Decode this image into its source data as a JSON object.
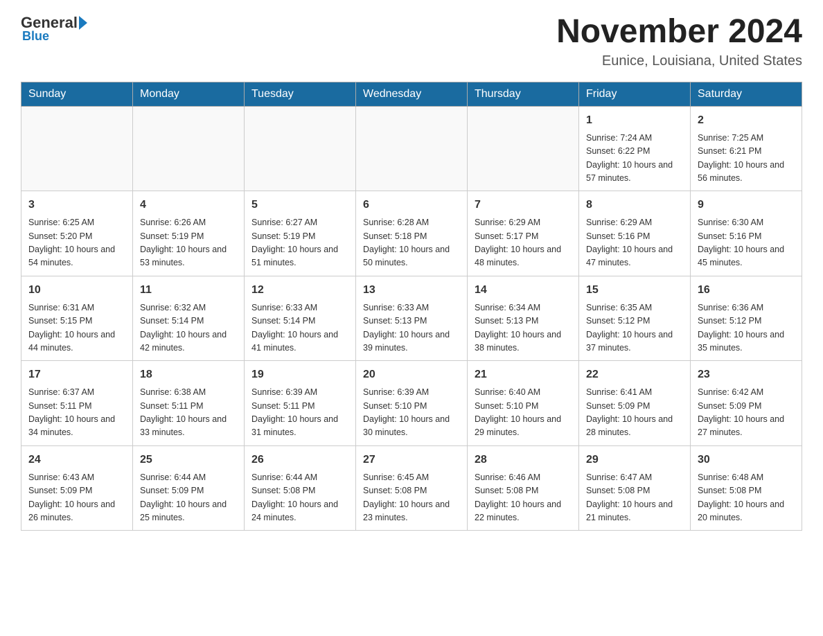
{
  "logo": {
    "general": "General",
    "blue": "Blue"
  },
  "title": {
    "month_year": "November 2024",
    "location": "Eunice, Louisiana, United States"
  },
  "headers": [
    "Sunday",
    "Monday",
    "Tuesday",
    "Wednesday",
    "Thursday",
    "Friday",
    "Saturday"
  ],
  "weeks": [
    [
      {
        "day": "",
        "sunrise": "",
        "sunset": "",
        "daylight": ""
      },
      {
        "day": "",
        "sunrise": "",
        "sunset": "",
        "daylight": ""
      },
      {
        "day": "",
        "sunrise": "",
        "sunset": "",
        "daylight": ""
      },
      {
        "day": "",
        "sunrise": "",
        "sunset": "",
        "daylight": ""
      },
      {
        "day": "",
        "sunrise": "",
        "sunset": "",
        "daylight": ""
      },
      {
        "day": "1",
        "sunrise": "Sunrise: 7:24 AM",
        "sunset": "Sunset: 6:22 PM",
        "daylight": "Daylight: 10 hours and 57 minutes."
      },
      {
        "day": "2",
        "sunrise": "Sunrise: 7:25 AM",
        "sunset": "Sunset: 6:21 PM",
        "daylight": "Daylight: 10 hours and 56 minutes."
      }
    ],
    [
      {
        "day": "3",
        "sunrise": "Sunrise: 6:25 AM",
        "sunset": "Sunset: 5:20 PM",
        "daylight": "Daylight: 10 hours and 54 minutes."
      },
      {
        "day": "4",
        "sunrise": "Sunrise: 6:26 AM",
        "sunset": "Sunset: 5:19 PM",
        "daylight": "Daylight: 10 hours and 53 minutes."
      },
      {
        "day": "5",
        "sunrise": "Sunrise: 6:27 AM",
        "sunset": "Sunset: 5:19 PM",
        "daylight": "Daylight: 10 hours and 51 minutes."
      },
      {
        "day": "6",
        "sunrise": "Sunrise: 6:28 AM",
        "sunset": "Sunset: 5:18 PM",
        "daylight": "Daylight: 10 hours and 50 minutes."
      },
      {
        "day": "7",
        "sunrise": "Sunrise: 6:29 AM",
        "sunset": "Sunset: 5:17 PM",
        "daylight": "Daylight: 10 hours and 48 minutes."
      },
      {
        "day": "8",
        "sunrise": "Sunrise: 6:29 AM",
        "sunset": "Sunset: 5:16 PM",
        "daylight": "Daylight: 10 hours and 47 minutes."
      },
      {
        "day": "9",
        "sunrise": "Sunrise: 6:30 AM",
        "sunset": "Sunset: 5:16 PM",
        "daylight": "Daylight: 10 hours and 45 minutes."
      }
    ],
    [
      {
        "day": "10",
        "sunrise": "Sunrise: 6:31 AM",
        "sunset": "Sunset: 5:15 PM",
        "daylight": "Daylight: 10 hours and 44 minutes."
      },
      {
        "day": "11",
        "sunrise": "Sunrise: 6:32 AM",
        "sunset": "Sunset: 5:14 PM",
        "daylight": "Daylight: 10 hours and 42 minutes."
      },
      {
        "day": "12",
        "sunrise": "Sunrise: 6:33 AM",
        "sunset": "Sunset: 5:14 PM",
        "daylight": "Daylight: 10 hours and 41 minutes."
      },
      {
        "day": "13",
        "sunrise": "Sunrise: 6:33 AM",
        "sunset": "Sunset: 5:13 PM",
        "daylight": "Daylight: 10 hours and 39 minutes."
      },
      {
        "day": "14",
        "sunrise": "Sunrise: 6:34 AM",
        "sunset": "Sunset: 5:13 PM",
        "daylight": "Daylight: 10 hours and 38 minutes."
      },
      {
        "day": "15",
        "sunrise": "Sunrise: 6:35 AM",
        "sunset": "Sunset: 5:12 PM",
        "daylight": "Daylight: 10 hours and 37 minutes."
      },
      {
        "day": "16",
        "sunrise": "Sunrise: 6:36 AM",
        "sunset": "Sunset: 5:12 PM",
        "daylight": "Daylight: 10 hours and 35 minutes."
      }
    ],
    [
      {
        "day": "17",
        "sunrise": "Sunrise: 6:37 AM",
        "sunset": "Sunset: 5:11 PM",
        "daylight": "Daylight: 10 hours and 34 minutes."
      },
      {
        "day": "18",
        "sunrise": "Sunrise: 6:38 AM",
        "sunset": "Sunset: 5:11 PM",
        "daylight": "Daylight: 10 hours and 33 minutes."
      },
      {
        "day": "19",
        "sunrise": "Sunrise: 6:39 AM",
        "sunset": "Sunset: 5:11 PM",
        "daylight": "Daylight: 10 hours and 31 minutes."
      },
      {
        "day": "20",
        "sunrise": "Sunrise: 6:39 AM",
        "sunset": "Sunset: 5:10 PM",
        "daylight": "Daylight: 10 hours and 30 minutes."
      },
      {
        "day": "21",
        "sunrise": "Sunrise: 6:40 AM",
        "sunset": "Sunset: 5:10 PM",
        "daylight": "Daylight: 10 hours and 29 minutes."
      },
      {
        "day": "22",
        "sunrise": "Sunrise: 6:41 AM",
        "sunset": "Sunset: 5:09 PM",
        "daylight": "Daylight: 10 hours and 28 minutes."
      },
      {
        "day": "23",
        "sunrise": "Sunrise: 6:42 AM",
        "sunset": "Sunset: 5:09 PM",
        "daylight": "Daylight: 10 hours and 27 minutes."
      }
    ],
    [
      {
        "day": "24",
        "sunrise": "Sunrise: 6:43 AM",
        "sunset": "Sunset: 5:09 PM",
        "daylight": "Daylight: 10 hours and 26 minutes."
      },
      {
        "day": "25",
        "sunrise": "Sunrise: 6:44 AM",
        "sunset": "Sunset: 5:09 PM",
        "daylight": "Daylight: 10 hours and 25 minutes."
      },
      {
        "day": "26",
        "sunrise": "Sunrise: 6:44 AM",
        "sunset": "Sunset: 5:08 PM",
        "daylight": "Daylight: 10 hours and 24 minutes."
      },
      {
        "day": "27",
        "sunrise": "Sunrise: 6:45 AM",
        "sunset": "Sunset: 5:08 PM",
        "daylight": "Daylight: 10 hours and 23 minutes."
      },
      {
        "day": "28",
        "sunrise": "Sunrise: 6:46 AM",
        "sunset": "Sunset: 5:08 PM",
        "daylight": "Daylight: 10 hours and 22 minutes."
      },
      {
        "day": "29",
        "sunrise": "Sunrise: 6:47 AM",
        "sunset": "Sunset: 5:08 PM",
        "daylight": "Daylight: 10 hours and 21 minutes."
      },
      {
        "day": "30",
        "sunrise": "Sunrise: 6:48 AM",
        "sunset": "Sunset: 5:08 PM",
        "daylight": "Daylight: 10 hours and 20 minutes."
      }
    ]
  ]
}
